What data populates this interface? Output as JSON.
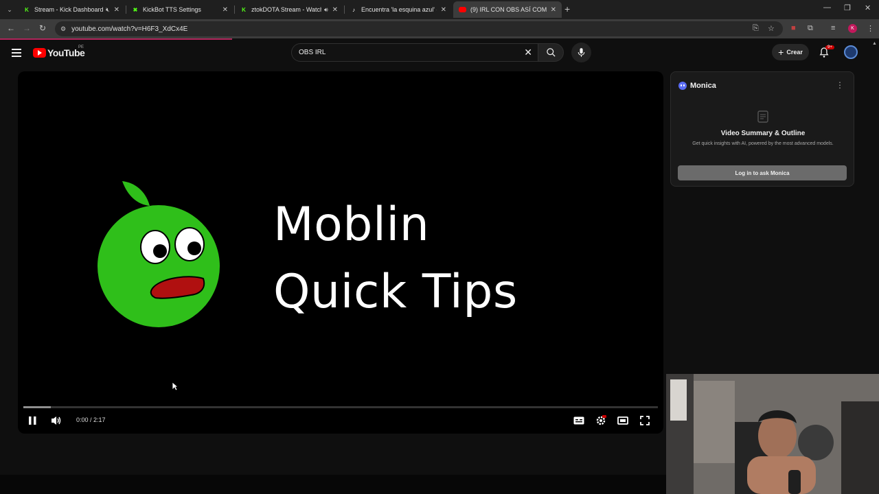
{
  "browser": {
    "tabs": [
      {
        "title": "Stream - Kick Dashboard",
        "favicon": "kick-icon",
        "muted": true
      },
      {
        "title": "KickBot TTS Settings",
        "favicon": "kickbot-icon"
      },
      {
        "title": "ztokDOTA Stream - Watch L",
        "favicon": "kick-icon",
        "audio": true
      },
      {
        "title": "Encuentra 'la esquina azul' en T",
        "favicon": "tiktok-icon"
      },
      {
        "title": "(9) IRL CON OBS ASÍ COMO LO",
        "favicon": "youtube-icon",
        "active": true
      }
    ],
    "url": "youtube.com/watch?v=H6F3_XdCx4E",
    "profile_initial": "K",
    "accent_color": "#b0255b"
  },
  "youtube": {
    "logo_text": "YouTube",
    "country_code": "PE",
    "search_query": "OBS IRL",
    "create_label": "Crear",
    "notification_count": "9+"
  },
  "player": {
    "slide_title_line1": "Moblin",
    "slide_title_line2": "Quick Tips",
    "time_display": "0:00 / 2:17",
    "progress_fraction": 0.0,
    "buffered_fraction": 0.043
  },
  "monica": {
    "name": "Monica",
    "heading": "Video Summary & Outline",
    "subtitle": "Get quick insights with AI, powered by the most advanced models.",
    "login_label": "Log in to ask Monica"
  },
  "colors": {
    "youtube_red": "#ff0000",
    "lime_green": "#2fbf1a",
    "mouth_red": "#b01010"
  }
}
